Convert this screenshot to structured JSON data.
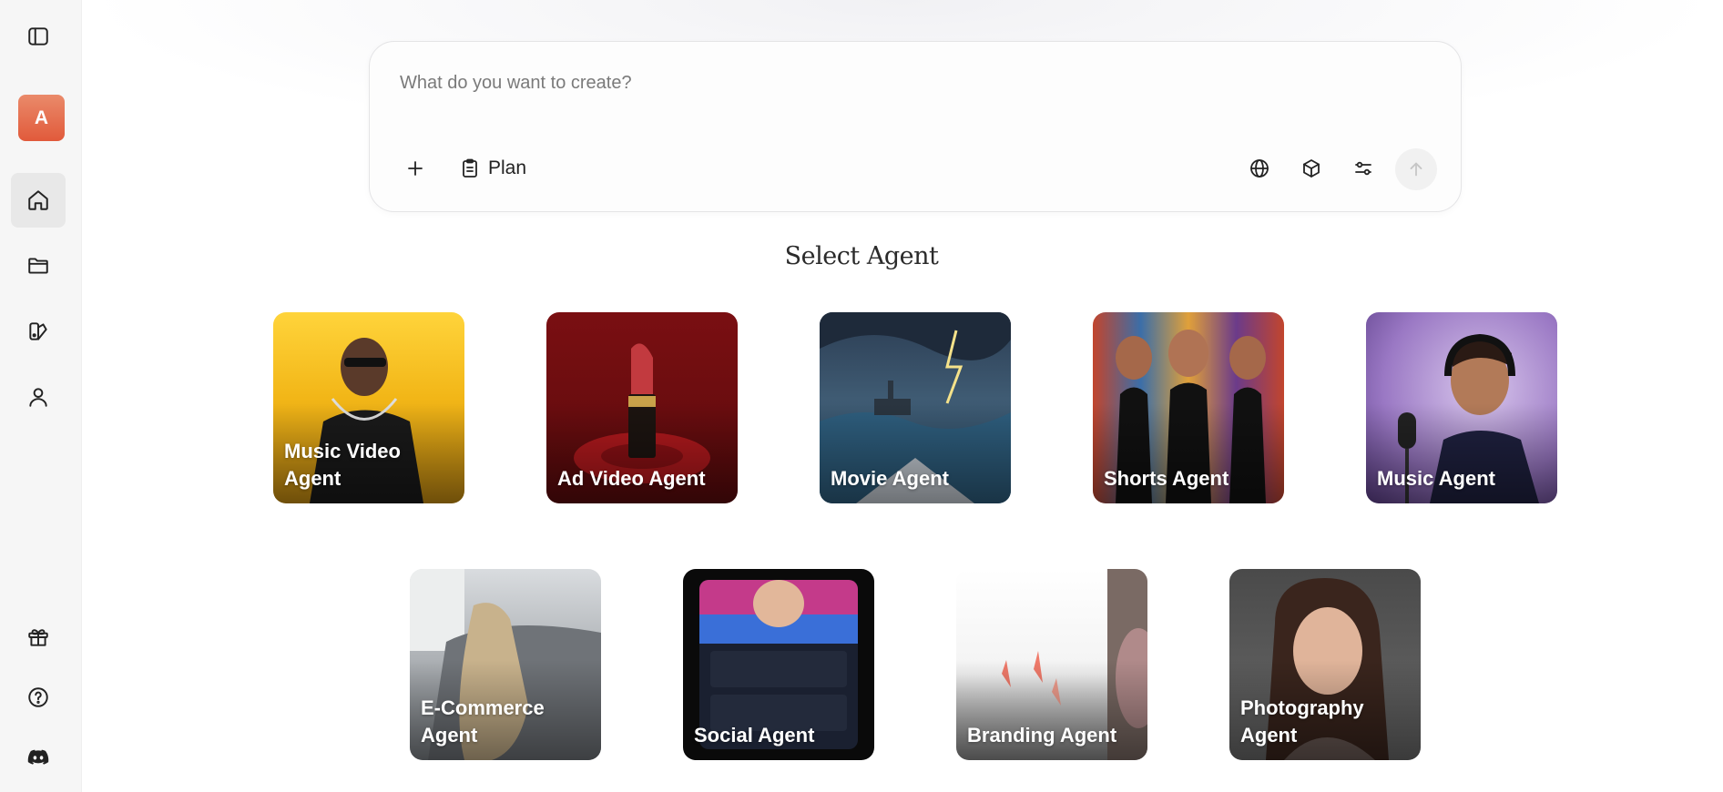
{
  "sidebar": {
    "avatar_initial": "A",
    "icons": [
      "sidebar-toggle-icon",
      "home-icon",
      "folder-icon",
      "templates-icon",
      "user-icon",
      "gift-icon",
      "help-icon",
      "discord-icon"
    ]
  },
  "prompt": {
    "placeholder": "What do you want to create?",
    "plan_label": "Plan"
  },
  "section_title": "Select Agent",
  "agents": [
    {
      "label": "Music Video Agent"
    },
    {
      "label": "Ad Video Agent"
    },
    {
      "label": "Movie Agent"
    },
    {
      "label": "Shorts Agent"
    },
    {
      "label": "Music Agent"
    },
    {
      "label": "E-Commerce Agent"
    },
    {
      "label": "Social Agent"
    },
    {
      "label": "Branding Agent"
    },
    {
      "label": "Photography Agent"
    }
  ],
  "colors": {
    "avatar": "#e4603f",
    "sidebar_bg": "#f6f6f6",
    "active_item_bg": "#e8e8e8"
  }
}
